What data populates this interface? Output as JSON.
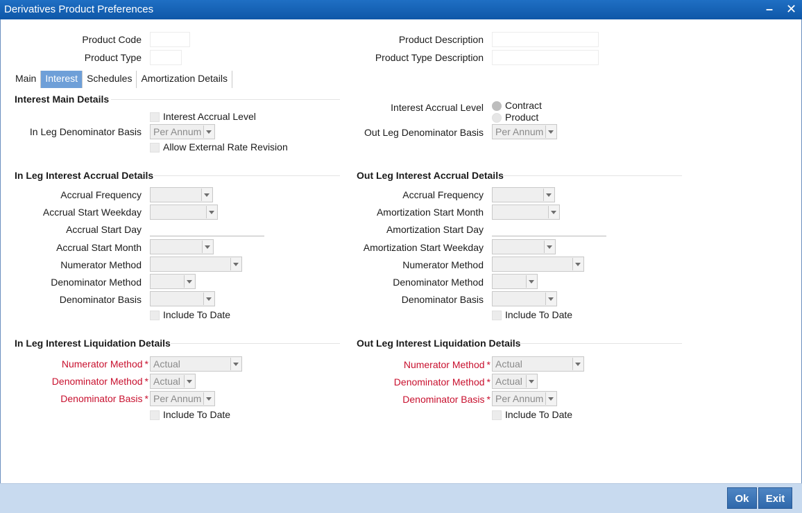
{
  "window": {
    "title": "Derivatives Product Preferences"
  },
  "header": {
    "product_code_label": "Product Code",
    "product_type_label": "Product Type",
    "product_description_label": "Product Description",
    "product_type_description_label": "Product Type Description"
  },
  "tabs": [
    {
      "label": "Main"
    },
    {
      "label": "Interest"
    },
    {
      "label": "Schedules"
    },
    {
      "label": "Amortization Details"
    }
  ],
  "interest_main": {
    "section_title": "Interest Main Details",
    "interest_accrual_level_chk": "Interest Accrual Level",
    "in_leg_denominator_basis_label": "In Leg Denominator Basis",
    "in_leg_denominator_basis_value": "Per Annum",
    "allow_external_rate_revision": "Allow External Rate Revision",
    "interest_accrual_level_label": "Interest Accrual Level",
    "radio_contract": "Contract",
    "radio_product": "Product",
    "out_leg_denominator_basis_label": "Out Leg Denominator Basis",
    "out_leg_denominator_basis_value": "Per Annum"
  },
  "in_leg_accrual": {
    "section_title": "In Leg Interest Accrual Details",
    "accrual_frequency": "Accrual Frequency",
    "accrual_start_weekday": "Accrual Start Weekday",
    "accrual_start_day": "Accrual Start Day",
    "accrual_start_month": "Accrual Start Month",
    "numerator_method": "Numerator Method",
    "denominator_method": "Denominator Method",
    "denominator_basis": "Denominator Basis",
    "include_to_date": "Include To Date"
  },
  "out_leg_accrual": {
    "section_title": "Out Leg Interest Accrual Details",
    "accrual_frequency": "Accrual Frequency",
    "amortization_start_month": "Amortization Start Month",
    "amortization_start_day": "Amortization Start Day",
    "amortization_start_weekday": "Amortization Start Weekday",
    "numerator_method": "Numerator Method",
    "denominator_method": "Denominator Method",
    "denominator_basis": "Denominator Basis",
    "include_to_date": "Include To Date"
  },
  "in_leg_liquidation": {
    "section_title": "In Leg Interest Liquidation Details",
    "numerator_method": "Numerator Method",
    "numerator_method_value": "Actual",
    "denominator_method": "Denominator Method",
    "denominator_method_value": "Actual",
    "denominator_basis": "Denominator Basis",
    "denominator_basis_value": "Per Annum",
    "include_to_date": "Include To Date",
    "required_mark": "*"
  },
  "out_leg_liquidation": {
    "section_title": "Out Leg Interest Liquidation Details",
    "numerator_method": "Numerator Method",
    "numerator_method_value": "Actual",
    "denominator_method": "Denominator Method",
    "denominator_method_value": "Actual",
    "denominator_basis": "Denominator Basis",
    "denominator_basis_value": "Per Annum",
    "include_to_date": "Include To Date",
    "required_mark": "*"
  },
  "footer": {
    "ok_label": "Ok",
    "exit_label": "Exit"
  },
  "colors": {
    "titlebar": "#0e57a8",
    "active_tab": "#6e9fd8",
    "required": "#c8102e",
    "footer": "#c8daef",
    "button": "#2f68ab"
  }
}
